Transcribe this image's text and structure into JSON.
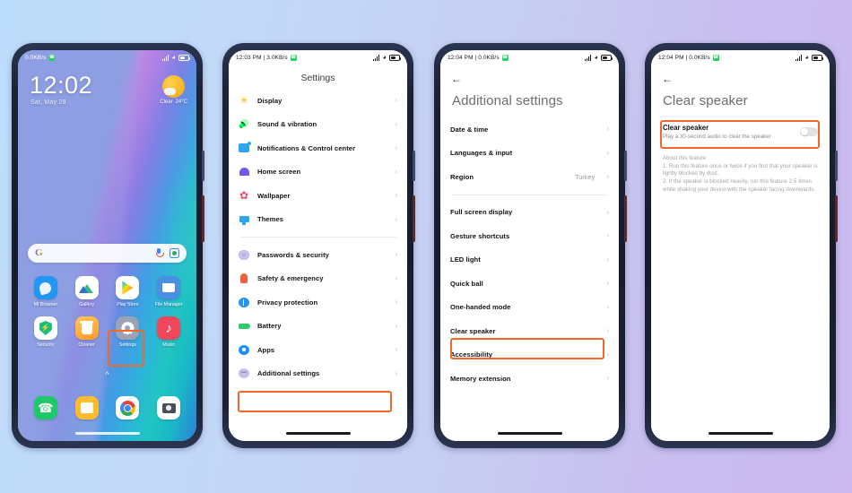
{
  "background": {
    "from": "#bcdcfb",
    "to": "#cbb9ef"
  },
  "accent": {
    "highlight": "#f1682a"
  },
  "phones": [
    {
      "id": "home-screen",
      "status_bar": {
        "left_text": "0.0KB/s",
        "badge_icon": "whatsapp-icon",
        "icons": [
          "signal-icon",
          "wifi-icon",
          "battery-icon"
        ]
      },
      "clock": "12:02",
      "date": "Sat, May 28",
      "weather": {
        "condition": "Clear",
        "temperature": "24°C",
        "icon": "sun-cloud-icon"
      },
      "search": {
        "logo": "google-g-icon",
        "mic": "mic-icon",
        "lens": "lens-icon"
      },
      "apps": [
        {
          "label": "Mi Browser",
          "icon": "mi-browser-icon"
        },
        {
          "label": "Gallery",
          "icon": "gallery-icon"
        },
        {
          "label": "Play Store",
          "icon": "play-store-icon"
        },
        {
          "label": "File Manager",
          "icon": "file-manager-icon"
        },
        {
          "label": "Security",
          "icon": "security-icon"
        },
        {
          "label": "Cleaner",
          "icon": "cleaner-icon"
        },
        {
          "label": "Settings",
          "icon": "settings-gear-icon"
        },
        {
          "label": "Music",
          "icon": "music-icon"
        }
      ],
      "drawer_arrow": "chevron-up-icon",
      "dock": [
        {
          "label": "Phone",
          "icon": "phone-icon"
        },
        {
          "label": "Messages",
          "icon": "messages-icon"
        },
        {
          "label": "Chrome",
          "icon": "chrome-icon"
        },
        {
          "label": "Camera",
          "icon": "camera-icon"
        }
      ]
    },
    {
      "id": "settings-list",
      "status_bar": {
        "left_text": "12:03 PM | 3.0KB/s",
        "badge_icon": "whatsapp-icon"
      },
      "title": "Settings",
      "group_one": [
        {
          "label": "Display",
          "icon": "brightness-icon"
        },
        {
          "label": "Sound & vibration",
          "icon": "speaker-icon"
        },
        {
          "label": "Notifications & Control center",
          "icon": "notification-icon"
        },
        {
          "label": "Home screen",
          "icon": "home-icon"
        },
        {
          "label": "Wallpaper",
          "icon": "wallpaper-icon"
        },
        {
          "label": "Themes",
          "icon": "themes-icon"
        }
      ],
      "group_two": [
        {
          "label": "Passwords & security",
          "icon": "fingerprint-icon"
        },
        {
          "label": "Safety & emergency",
          "icon": "siren-icon"
        },
        {
          "label": "Privacy protection",
          "icon": "privacy-icon"
        },
        {
          "label": "Battery",
          "icon": "battery-icon"
        },
        {
          "label": "Apps",
          "icon": "apps-icon"
        },
        {
          "label": "Additional settings",
          "icon": "ellipsis-icon",
          "highlighted": true
        }
      ]
    },
    {
      "id": "additional-settings",
      "status_bar": {
        "left_text": "12:04 PM | 0.0KB/s",
        "badge_icon": "whatsapp-icon"
      },
      "back_icon": "back-arrow-icon",
      "title": "Additional settings",
      "group_one": [
        {
          "label": "Date & time",
          "value": ""
        },
        {
          "label": "Languages & input",
          "value": ""
        },
        {
          "label": "Region",
          "value": "Turkey"
        }
      ],
      "group_two": [
        {
          "label": "Full screen display",
          "value": ""
        },
        {
          "label": "Gesture shortcuts",
          "value": ""
        },
        {
          "label": "LED light",
          "value": ""
        },
        {
          "label": "Quick ball",
          "value": ""
        },
        {
          "label": "One-handed mode",
          "value": ""
        },
        {
          "label": "Clear speaker",
          "value": "",
          "highlighted": true
        },
        {
          "label": "Accessibility",
          "value": ""
        },
        {
          "label": "Memory extension",
          "value": ""
        }
      ]
    },
    {
      "id": "clear-speaker",
      "status_bar": {
        "left_text": "12:04 PM | 0.0KB/s",
        "badge_icon": "whatsapp-icon"
      },
      "back_icon": "back-arrow-icon",
      "title": "Clear speaker",
      "toggle_row": {
        "title": "Clear speaker",
        "subtitle": "Play a 30-second audio to clear the speaker",
        "state": "off"
      },
      "about": {
        "heading": "About this feature",
        "line1": "1. Run this feature once or twice if you find that your speaker is lightly blocked by dust.",
        "line2": "2. If the speaker is blocked heavily, run this feature 2-5 times while shaking your device with the speaker facing downwards."
      }
    }
  ]
}
